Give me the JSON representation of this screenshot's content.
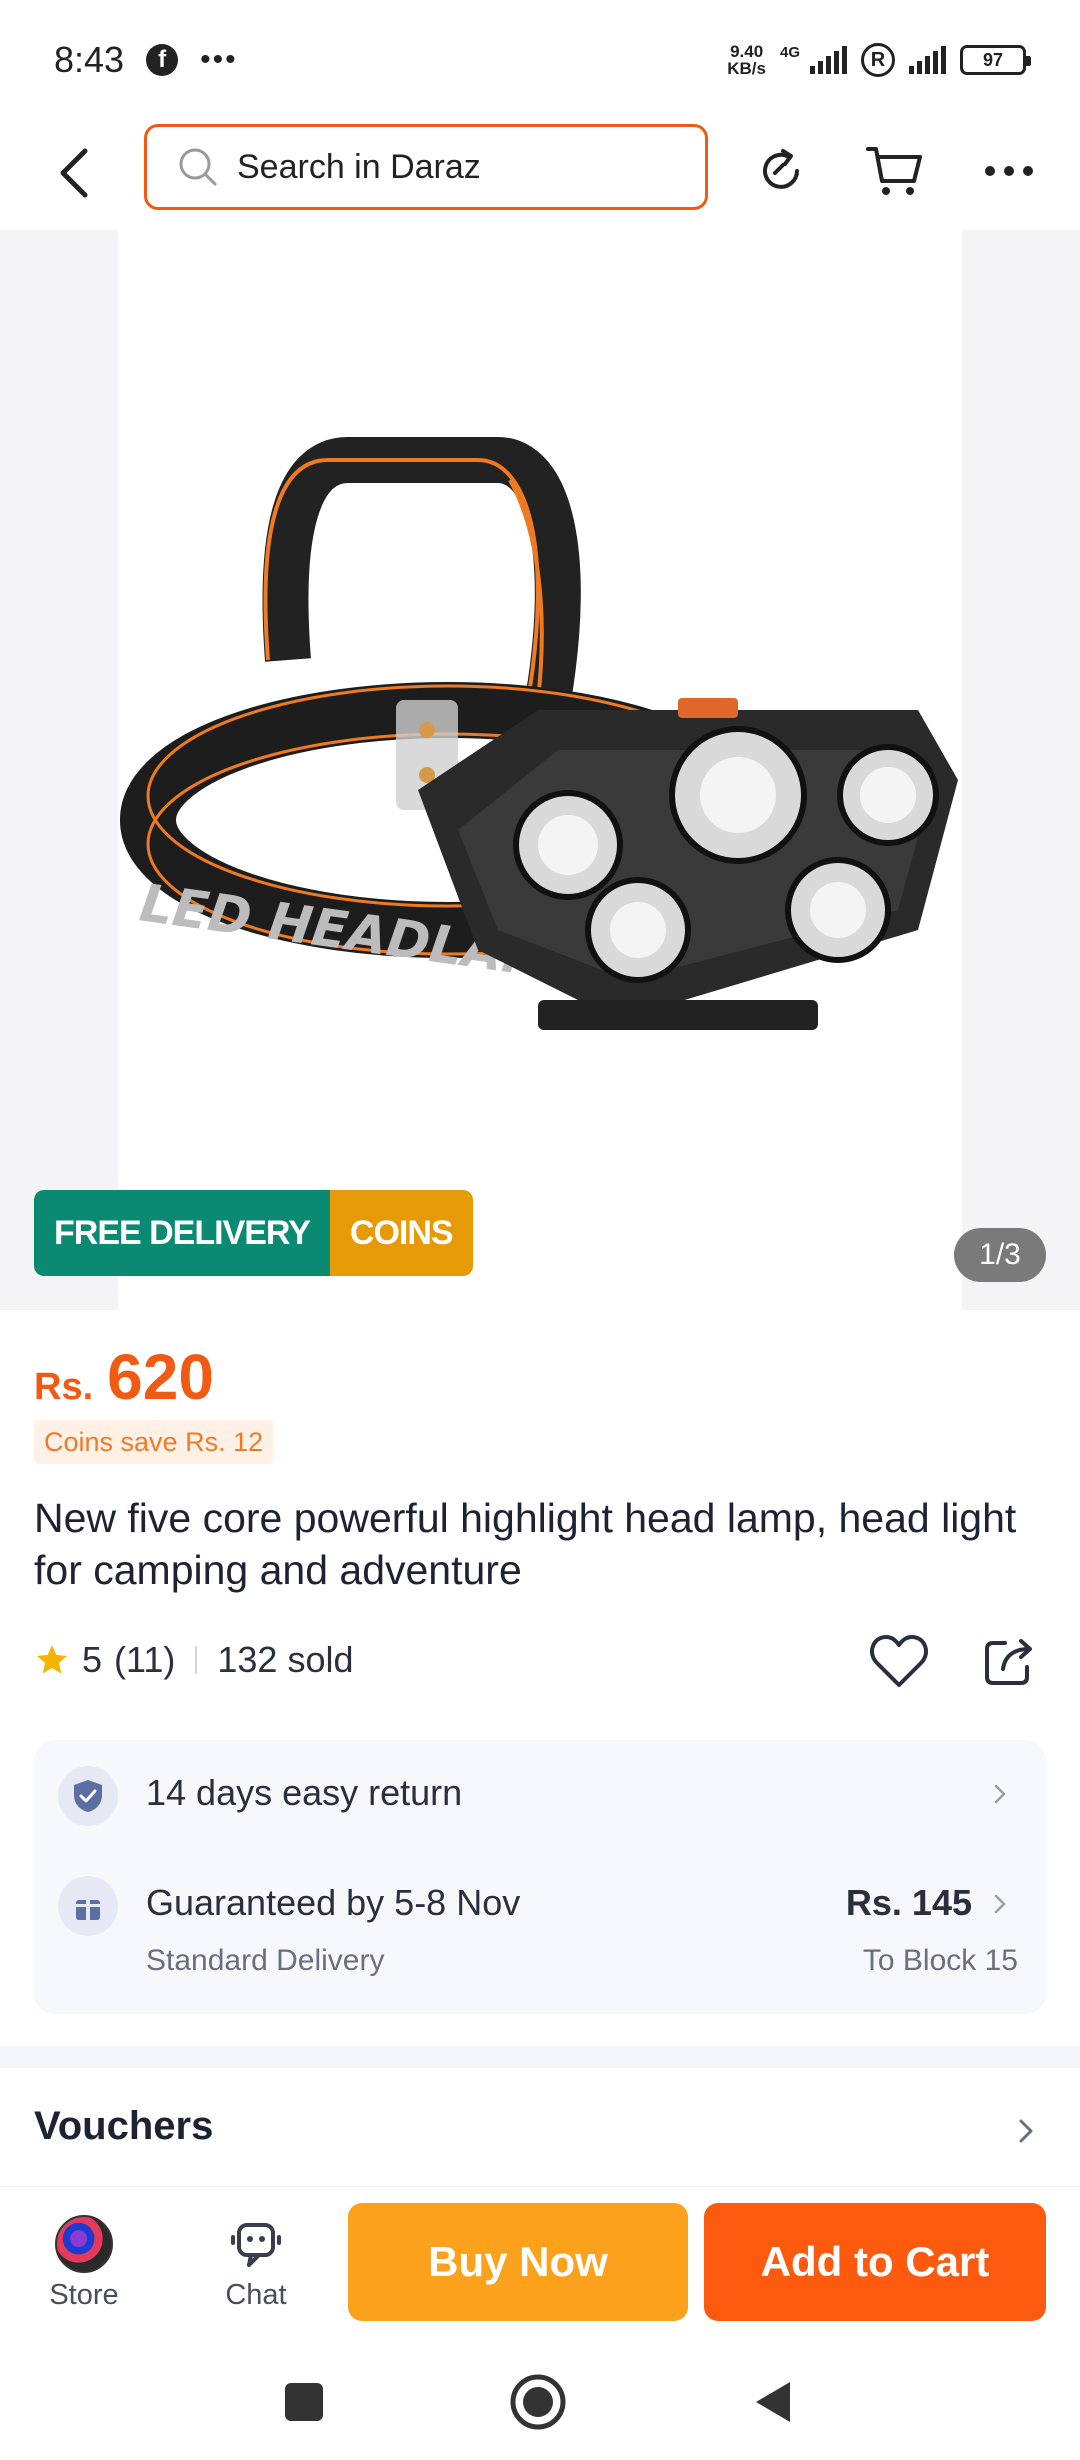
{
  "status_bar": {
    "time": "8:43",
    "facebook_glyph": "f",
    "more": "•••",
    "net_speed_value": "9.40",
    "net_speed_unit": "KB/s",
    "network_type": "4G",
    "roaming": "R",
    "battery": "97"
  },
  "top_nav": {
    "search_placeholder": "Search in Daraz",
    "icons": [
      "back-arrow-icon",
      "search-icon",
      "share-refresh-icon",
      "cart-icon",
      "more-icon"
    ]
  },
  "gallery": {
    "badge_free_delivery": "FREE DELIVERY",
    "badge_coins": "COINS",
    "counter": "1/3",
    "product_strap_text": "LED HEADLAMP"
  },
  "product": {
    "currency": "Rs.",
    "price": "620",
    "coins_save": "Coins save Rs. 12",
    "title": "New five core powerful highlight head lamp, head light for camping and adventure",
    "rating": "5",
    "review_count": "(11)",
    "sold": "132 sold"
  },
  "services": {
    "return_label": "14 days easy return",
    "delivery_label": "Guaranteed by 5-8 Nov",
    "delivery_type": "Standard Delivery",
    "delivery_price": "Rs. 145",
    "delivery_destination": "To Block 15"
  },
  "vouchers": {
    "title": "Vouchers"
  },
  "action_bar": {
    "store_label": "Store",
    "chat_label": "Chat",
    "buy_now_label": "Buy Now",
    "add_to_cart_label": "Add to Cart"
  },
  "colors": {
    "brand_orange": "#f05a13",
    "buy_now": "#fba11b",
    "add_to_cart": "#fb5a0f",
    "free_delivery_green": "#0a8a72",
    "coins_amber": "#e79a08",
    "star": "#f5b400"
  }
}
